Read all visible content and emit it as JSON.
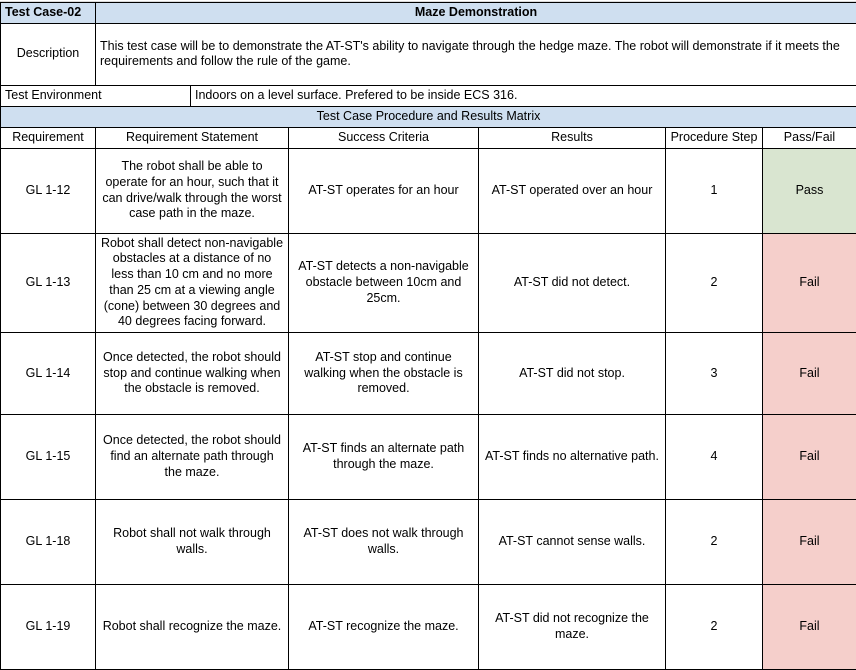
{
  "header": {
    "test_case_label": "Test Case-02",
    "demo_title": "Maze Demonstration",
    "description_label": "Description",
    "description_text": "This test case will be to demonstrate the AT-ST's ability to navigate through the hedge maze. The robot will demonstrate if it meets the requirements and follow the rule of the game.",
    "environment_label": "Test Environment",
    "environment_value": "Indoors on a level surface. Prefered to be inside ECS 316."
  },
  "matrix": {
    "banner": "Test Case Procedure and Results Matrix",
    "columns": [
      "Requirement",
      "Requirement Statement",
      "Success Criteria",
      "Results",
      "Procedure Step",
      "Pass/Fail"
    ],
    "rows": [
      {
        "requirement": "GL 1-12",
        "statement": "The robot shall be able to operate for an hour, such that it can drive/walk through the worst case path in the maze.",
        "success_criteria": "AT-ST operates for an hour",
        "results": "AT-ST operated over an hour",
        "procedure_step": "1",
        "pass_fail": "Pass",
        "status": "pass"
      },
      {
        "requirement": "GL 1-13",
        "statement": "Robot shall detect non-navigable obstacles at a distance of no less than 10 cm and no more than 25 cm at a viewing angle (cone) between 30 degrees and 40 degrees facing forward.",
        "success_criteria": "AT-ST detects a non-navigable obstacle between 10cm and 25cm.",
        "results": "AT-ST did not detect.",
        "procedure_step": "2",
        "pass_fail": "Fail",
        "status": "fail"
      },
      {
        "requirement": "GL 1-14",
        "statement": "Once detected, the robot should stop and continue walking when the obstacle is removed.",
        "success_criteria": "AT-ST stop and continue walking when the obstacle is removed.",
        "results": "AT-ST did not stop.",
        "procedure_step": "3",
        "pass_fail": "Fail",
        "status": "fail"
      },
      {
        "requirement": "GL 1-15",
        "statement": "Once detected, the robot should find an alternate path through the maze.",
        "success_criteria": "AT-ST finds an alternate path through the maze.",
        "results": "AT-ST finds no alternative path.",
        "procedure_step": "4",
        "pass_fail": "Fail",
        "status": "fail"
      },
      {
        "requirement": "GL 1-18",
        "statement": "Robot shall not walk through walls.",
        "success_criteria": "AT-ST does not walk through walls.",
        "results": "AT-ST cannot sense walls.",
        "procedure_step": "2",
        "pass_fail": "Fail",
        "status": "fail"
      },
      {
        "requirement": "GL 1-19",
        "statement": "Robot shall recognize the maze.",
        "success_criteria": "AT-ST recognize the maze.",
        "results": "AT-ST did not recognize the maze.",
        "procedure_step": "2",
        "pass_fail": "Fail",
        "status": "fail"
      }
    ]
  },
  "colors": {
    "header_blue": "#cfdff0",
    "pass_green": "#d9e5d0",
    "fail_pink": "#f5cfcb",
    "border": "#000000"
  }
}
